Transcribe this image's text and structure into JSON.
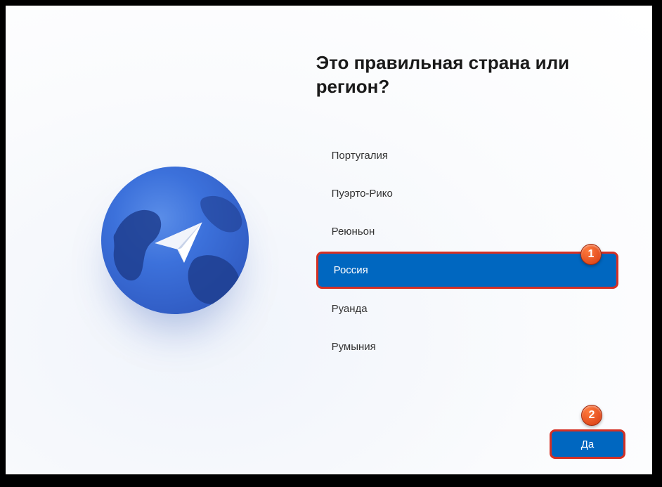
{
  "heading": "Это правильная страна или регион?",
  "countries": [
    {
      "label": "Португалия",
      "selected": false
    },
    {
      "label": "Пуэрто-Рико",
      "selected": false
    },
    {
      "label": "Реюньон",
      "selected": false
    },
    {
      "label": "Россия",
      "selected": true
    },
    {
      "label": "Руанда",
      "selected": false
    },
    {
      "label": "Румыния",
      "selected": false
    }
  ],
  "confirm_label": "Да",
  "callouts": {
    "one": "1",
    "two": "2"
  }
}
